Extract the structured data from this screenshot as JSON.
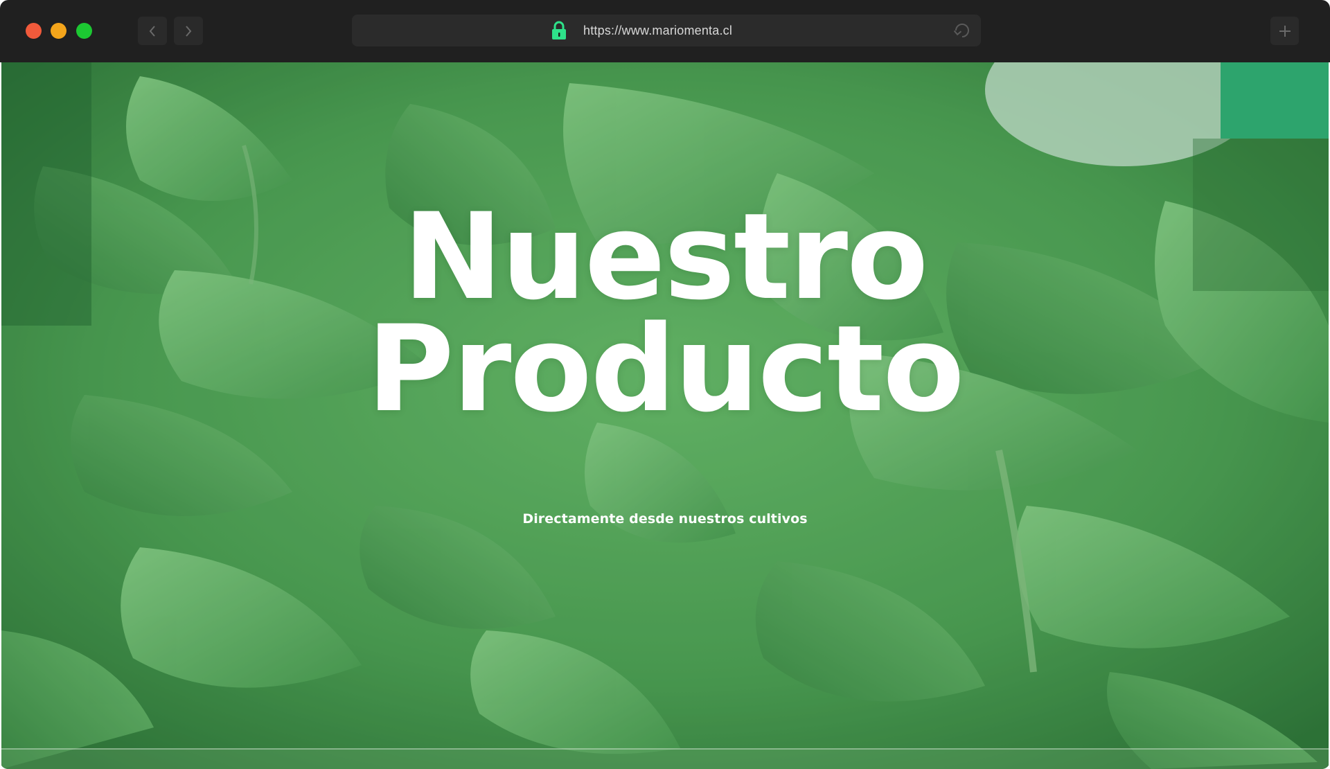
{
  "browser": {
    "url": "https://www.mariomenta.cl",
    "icons": {
      "back": "chevron-left-icon",
      "forward": "chevron-right-icon",
      "secure": "lock-icon",
      "reload": "reload-icon",
      "new_tab": "plus-icon"
    },
    "colors": {
      "titlebar": "#202020",
      "close": "#f15a3b",
      "minimize": "#f4a51b",
      "maximize": "#1cc832",
      "lock": "#2ee28a"
    }
  },
  "hero": {
    "title_line1": "Nuestro",
    "title_line2": "Producto",
    "subtitle": "Directamente desde nuestros cultivos",
    "background": "mint-leaves-photo",
    "colors": {
      "text": "#ffffff",
      "leaf_dark": "#2f7a3a",
      "leaf_light": "#7cc47d"
    }
  }
}
